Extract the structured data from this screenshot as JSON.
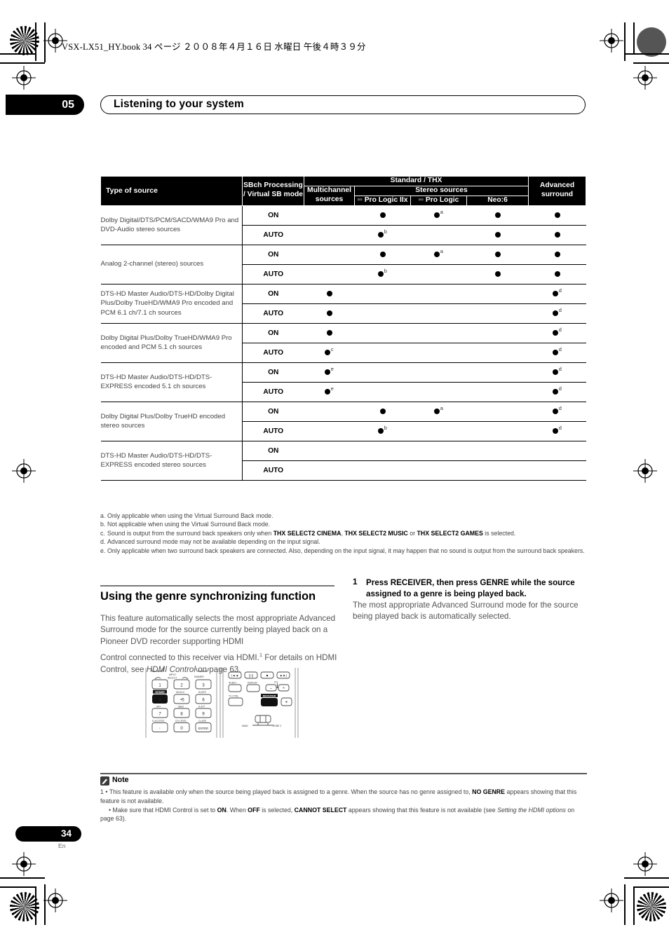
{
  "file_header": "VSX-LX51_HY.book   34 ページ   ２００８年４月１６日   水曜日   午後４時３９分",
  "chapter": {
    "number": "05",
    "title": "Listening to your system"
  },
  "table": {
    "headers": {
      "type_of_source": "Type of source",
      "sbch": "SBch Processing / Virtual SB mode",
      "standard_thx": "Standard / THX",
      "multichannel": "Multichannel sources",
      "stereo_sources": "Stereo sources",
      "pro_logic_iix": "Pro Logic IIx",
      "pro_logic": "Pro Logic",
      "neo6": "Neo:6",
      "advanced_surround": "Advanced surround"
    },
    "dolby_mark": "▫▫",
    "rows": [
      {
        "source": "Dolby Digital/DTS/PCM/SACD/WMA9 Pro and DVD-Audio stereo sources",
        "modes": [
          {
            "mode": "ON",
            "multichannel": "",
            "plx": "dot",
            "pl": "dot-a",
            "neo6": "dot",
            "adv": "dot"
          },
          {
            "mode": "AUTO",
            "multichannel": "",
            "plx": "dot-b",
            "pl": "",
            "neo6": "dot",
            "adv": "dot"
          }
        ]
      },
      {
        "source": "Analog 2-channel (stereo) sources",
        "modes": [
          {
            "mode": "ON",
            "multichannel": "",
            "plx": "dot",
            "pl": "dot-a",
            "neo6": "dot",
            "adv": "dot"
          },
          {
            "mode": "AUTO",
            "multichannel": "",
            "plx": "dot-b",
            "pl": "",
            "neo6": "dot",
            "adv": "dot"
          }
        ]
      },
      {
        "source": "DTS-HD Master Audio/DTS-HD/Dolby Digital Plus/Dolby TrueHD/WMA9 Pro encoded and PCM 6.1 ch/7.1 ch sources",
        "modes": [
          {
            "mode": "ON",
            "multichannel": "dot",
            "plx": "",
            "pl": "",
            "neo6": "",
            "adv": "dot-d"
          },
          {
            "mode": "AUTO",
            "multichannel": "dot",
            "plx": "",
            "pl": "",
            "neo6": "",
            "adv": "dot-d"
          }
        ]
      },
      {
        "source": "Dolby Digital Plus/Dolby TrueHD/WMA9 Pro encoded and PCM 5.1 ch sources",
        "modes": [
          {
            "mode": "ON",
            "multichannel": "dot",
            "plx": "",
            "pl": "",
            "neo6": "",
            "adv": "dot-d"
          },
          {
            "mode": "AUTO",
            "multichannel": "dot-c",
            "plx": "",
            "pl": "",
            "neo6": "",
            "adv": "dot-d"
          }
        ]
      },
      {
        "source": "DTS-HD Master Audio/DTS-HD/DTS-EXPRESS encoded 5.1 ch sources",
        "modes": [
          {
            "mode": "ON",
            "multichannel": "dot-e",
            "plx": "",
            "pl": "",
            "neo6": "",
            "adv": "dot-d"
          },
          {
            "mode": "AUTO",
            "multichannel": "dot-e",
            "plx": "",
            "pl": "",
            "neo6": "",
            "adv": "dot-d"
          }
        ]
      },
      {
        "source": "Dolby Digital Plus/Dolby TrueHD encoded stereo sources",
        "modes": [
          {
            "mode": "ON",
            "multichannel": "",
            "plx": "dot",
            "pl": "dot-a",
            "neo6": "",
            "adv": "dot-d"
          },
          {
            "mode": "AUTO",
            "multichannel": "",
            "plx": "dot-b",
            "pl": "",
            "neo6": "",
            "adv": "dot-d"
          }
        ]
      },
      {
        "source": "DTS-HD Master Audio/DTS-HD/DTS-EXPRESS encoded stereo sources",
        "modes": [
          {
            "mode": "ON",
            "multichannel": "",
            "plx": "",
            "pl": "",
            "neo6": "",
            "adv": ""
          },
          {
            "mode": "AUTO",
            "multichannel": "",
            "plx": "",
            "pl": "",
            "neo6": "",
            "adv": ""
          }
        ]
      }
    ]
  },
  "footnotes": [
    {
      "label": "a.",
      "text": "Only applicable when using the Virtual Surround Back mode."
    },
    {
      "label": "b.",
      "text": "Not applicable when using the Virtual Surround Back mode."
    },
    {
      "label": "c.",
      "text": "Sound is output from the surround back speakers only when THX SELECT2 CINEMA, THX SELECT2 MUSIC or THX SELECT2 GAMES is selected."
    },
    {
      "label": "d.",
      "text": "Advanced surround mode may not be available depending on the input signal."
    },
    {
      "label": "e.",
      "text": "Only applicable when two surround back speakers are connected. Also, depending on the input signal, it may happen that no sound is output from the surround back speakers."
    }
  ],
  "section": {
    "heading": "Using the genre synchronizing function",
    "para1": "This feature automatically selects the most appropriate Advanced Surround mode for the source currently being played back on a Pioneer DVD recorder supporting HDMI",
    "para2_pre": "Control connected to this receiver via HDMI.",
    "para2_sup": "1",
    "para2_mid": " For details on HDMI Control, see ",
    "para2_italic": "HDMI Control",
    "para2_post": " on page 63."
  },
  "step": {
    "number": "1",
    "heading": "Press RECEIVER, then press GENRE while the source assigned to a genre is being played back.",
    "body": "The most appropriate Advanced Surround mode for the source being played back is automatically selected."
  },
  "remote": {
    "left_panel": {
      "input_select": "INPUT SELECT",
      "dimmer": "DIMMER",
      "genre": "GENRE",
      "mcacc": "MCACC",
      "sleep": "SLEEP",
      "sr_plus": "SR+",
      "stbch": "SBch",
      "a_att": "A.ATT",
      "d_access": "D.ACCESS",
      "ch_level": "CH LEVEL",
      "class": "CLASS",
      "enter": "ENTER",
      "keys": [
        "1",
        "2",
        "3",
        "4",
        "5",
        "6",
        "7",
        "8",
        "9",
        "0"
      ],
      "highlighted_key": "4"
    },
    "right_panel": {
      "audio": "AUDIO",
      "display": "DISPLAY",
      "ch": "CH",
      "minus": "–",
      "plus": "+",
      "tv_ctrl": "TV CTRL",
      "receiver": "RECEIVER",
      "main": "MAIN",
      "zone2": "ZONE 2",
      "highlighted_button": "RECEIVER"
    }
  },
  "note": {
    "title": "Note",
    "item1": "This feature is available only when the source being played back is assigned to a genre. When the source has no genre assigned to, NO GENRE appears showing that this feature is not available.",
    "item1_num": "1",
    "item2_pre": "Make sure that HDMI Control is set to ",
    "item2_on": "ON",
    "item2_mid": ". When ",
    "item2_off": "OFF",
    "item2_mid2": " is selected, ",
    "item2_cannot": "CANNOT SELECT",
    "item2_post": " appears showing that this feature is not available (see ",
    "item2_italic": "Setting the HDMI options",
    "item2_end": " on page 63)."
  },
  "page": {
    "number": "34",
    "lang": "En"
  }
}
